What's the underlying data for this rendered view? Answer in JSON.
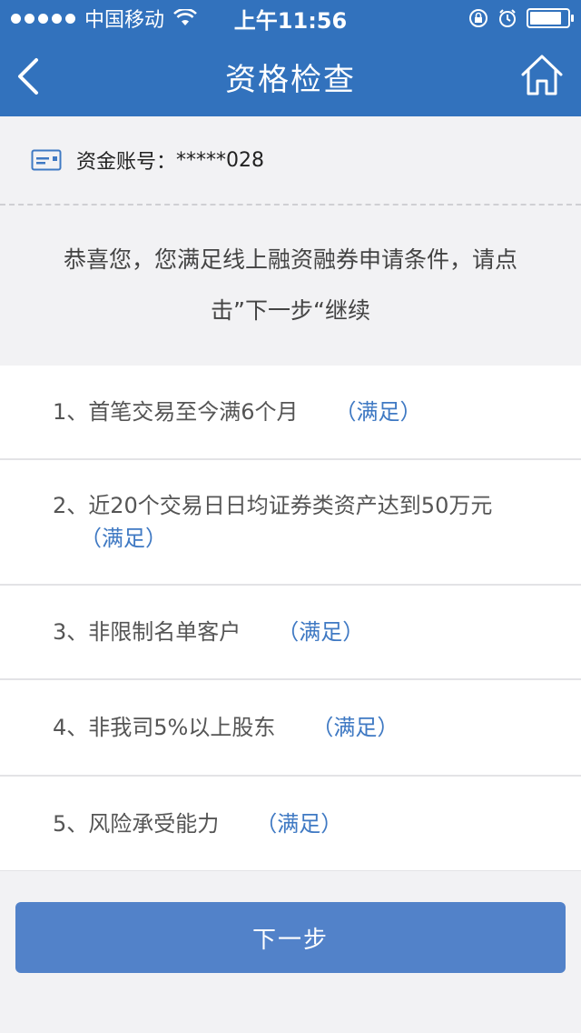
{
  "status_bar": {
    "carrier": "中国移动",
    "time": "上午11:56",
    "battery_level": 0.85
  },
  "nav": {
    "title": "资格检查"
  },
  "account": {
    "label": "资金账号：",
    "value": "*****028"
  },
  "message": "恭喜您，您满足线上融资融券申请条件，请点击”下一步“继续",
  "conditions": [
    {
      "text": "1、首笔交易至今满6个月",
      "status": "（满足）"
    },
    {
      "text": "2、近20个交易日日均证券类资产达到50万元",
      "status": "（满足）"
    },
    {
      "text": "3、非限制名单客户",
      "status": "（满足）"
    },
    {
      "text": "4、非我司5%以上股东",
      "status": "（满足）"
    },
    {
      "text": "5、风险承受能力",
      "status": "（满足）"
    }
  ],
  "button": {
    "next_label": "下一步"
  },
  "colors": {
    "primary": "#3272bd",
    "button": "#5282c9",
    "status_ok": "#3f79c3",
    "background": "#f2f2f4"
  }
}
